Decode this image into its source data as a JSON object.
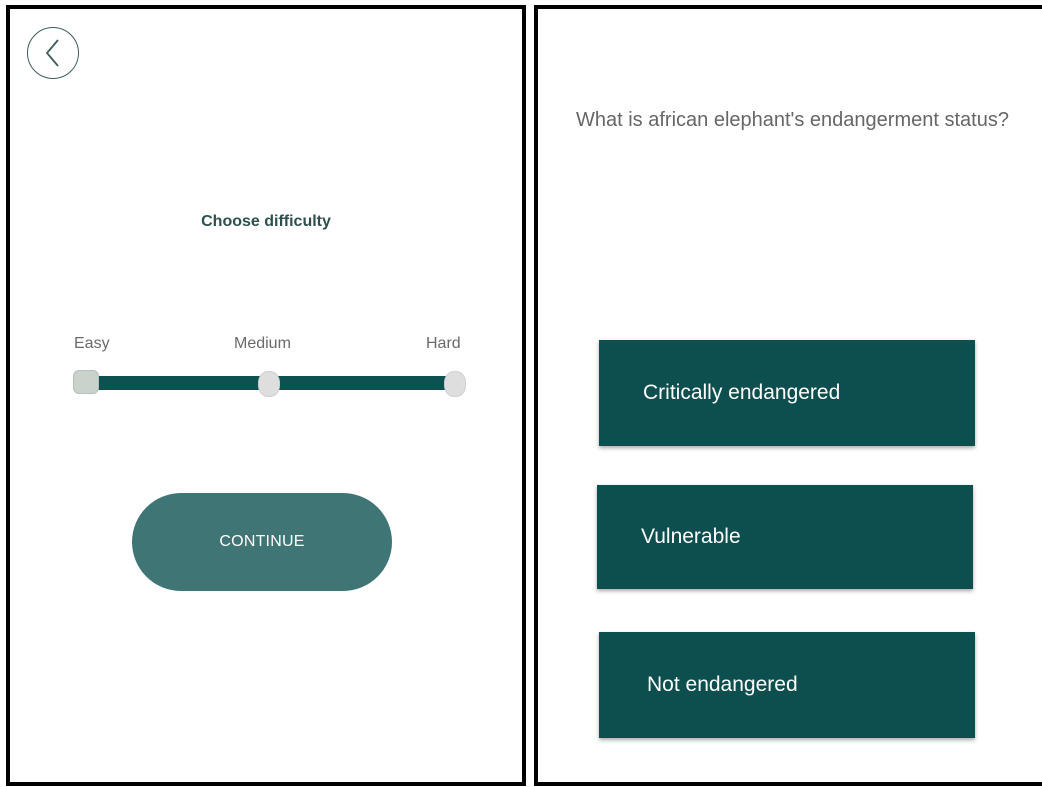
{
  "difficulty_screen": {
    "back_icon": "chevron-left-icon",
    "title": "Choose difficulty",
    "levels": [
      "Easy",
      "Medium",
      "Hard"
    ],
    "selected_level": "Easy",
    "continue_label": "CONTINUE",
    "colors": {
      "accent": "#0d5151",
      "button": "#3f7675",
      "title": "#2f4f4f"
    }
  },
  "quiz_screen": {
    "question": "What is african elephant's endangerment status?",
    "answers": [
      "Critically endangered",
      "Vulnerable",
      "Not endangered"
    ],
    "colors": {
      "answer_bg": "#0d4f4f",
      "question_text": "#666666"
    }
  }
}
